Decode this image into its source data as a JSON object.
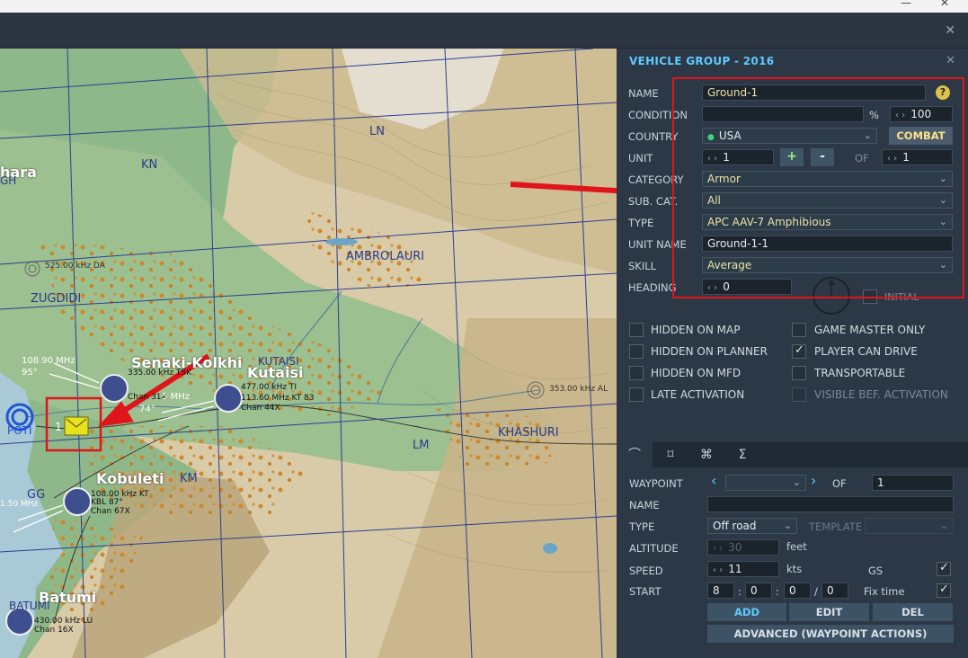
{
  "window": {
    "minimize": "—",
    "close": "✕",
    "sub_close": "✕"
  },
  "map": {
    "labels": {
      "hara": "hara",
      "kn": "KN",
      "ln": "LN",
      "gh": "GH",
      "ambrolauri": "AMBROLAURI",
      "zugdidi": "ZUGDIDI",
      "senaki": "Senaki-Kolkhi",
      "kutaisi_big": "Kutaisi",
      "kutaisi_small": "KUTAISI",
      "lm": "LM",
      "khashuri": "KHASHURI",
      "km": "KM",
      "kobuleti": "Kobuleti",
      "gg": "GG",
      "batumi": "Batumi",
      "batumi_small": "BATUMI",
      "poti": "POTI"
    },
    "beacons": {
      "da": "525.00 kHz DA",
      "al": "353.00 kHz AL",
      "freq_108": "108.90 MHz",
      "deg95": "95°",
      "deg74": "74°",
      "freq_1150": "1.50 MHz",
      "senaki_freq": "335.00 kHz TSK",
      "senaki_chan": "Chan 31X",
      "kutaisi_freq": "477.00 kHz TI",
      "kutaisi_ils": "113.60 MHz KT 83",
      "kutaisi_chan": "Chan 44X",
      "mhz_short": "5 MHz",
      "kobuleti_freq": "108.00 kHz KT",
      "kobuleti_kbl": "KBL 87°",
      "kobuleti_chan": "Chan 67X",
      "batumi_freq": "430.00 kHz LU",
      "batumi_chan": "Chan 16X",
      "unit_number": "1"
    }
  },
  "panel": {
    "title": "VEHICLE GROUP - 2016",
    "close": "✕",
    "name_label": "NAME",
    "name_value": "Ground-1",
    "help": "?",
    "condition_label": "CONDITION",
    "condition_value": "",
    "percent": "%",
    "condition_pct": "100",
    "country_label": "COUNTRY",
    "country_value": "USA",
    "combat_label": "COMBAT",
    "unit_label": "UNIT",
    "unit_value": "1",
    "plus": "+",
    "minus": "-",
    "of_label": "OF",
    "unit_total": "1",
    "category_label": "CATEGORY",
    "category_value": "Armor",
    "subcat_label": "SUB. CAT.",
    "subcat_value": "All",
    "type_label": "TYPE",
    "type_value": "APC AAV-7 Amphibious",
    "unitname_label": "UNIT NAME",
    "unitname_value": "Ground-1-1",
    "skill_label": "SKILL",
    "skill_value": "Average",
    "heading_label": "HEADING",
    "heading_value": "0",
    "initial_label": "INITIAL",
    "checkboxes": [
      {
        "label": "HIDDEN ON MAP",
        "checked": false
      },
      {
        "label": "GAME MASTER ONLY",
        "checked": false
      },
      {
        "label": "HIDDEN ON PLANNER",
        "checked": false
      },
      {
        "label": "PLAYER CAN DRIVE",
        "checked": true
      },
      {
        "label": "HIDDEN ON MFD",
        "checked": false
      },
      {
        "label": "TRANSPORTABLE",
        "checked": false
      },
      {
        "label": "LATE ACTIVATION",
        "checked": false
      },
      {
        "label": "VISIBLE BEF. ACTIVATION",
        "checked": false
      }
    ],
    "tabs": [
      "route-icon",
      "target-icon",
      "command-icon",
      "sigma-icon"
    ],
    "tab_glyphs": [
      "⌒",
      "⌑",
      "⌘",
      "Σ"
    ],
    "waypoint": {
      "waypoint_label": "WAYPOINT",
      "waypoint_value": "",
      "of_label": "OF",
      "waypoint_total": "1",
      "name_label": "NAME",
      "name_value": "",
      "type_label": "TYPE",
      "type_value": "Off road",
      "template_label": "TEMPLATE",
      "template_value": "",
      "altitude_label": "ALTITUDE",
      "altitude_value": "30",
      "altitude_unit": "feet",
      "speed_label": "SPEED",
      "speed_value": "11",
      "speed_unit": "kts",
      "gs_label": "GS",
      "gs_checked": true,
      "start_label": "START",
      "start_d": "8",
      "start_h": "0",
      "start_m": "0",
      "start_s": "0",
      "colon": ":",
      "slash": "/",
      "fixtime_label": "Fix time",
      "fixtime_checked": true,
      "add": "ADD",
      "edit": "EDIT",
      "del": "DEL",
      "advanced": "ADVANCED (WAYPOINT ACTIONS)"
    }
  }
}
